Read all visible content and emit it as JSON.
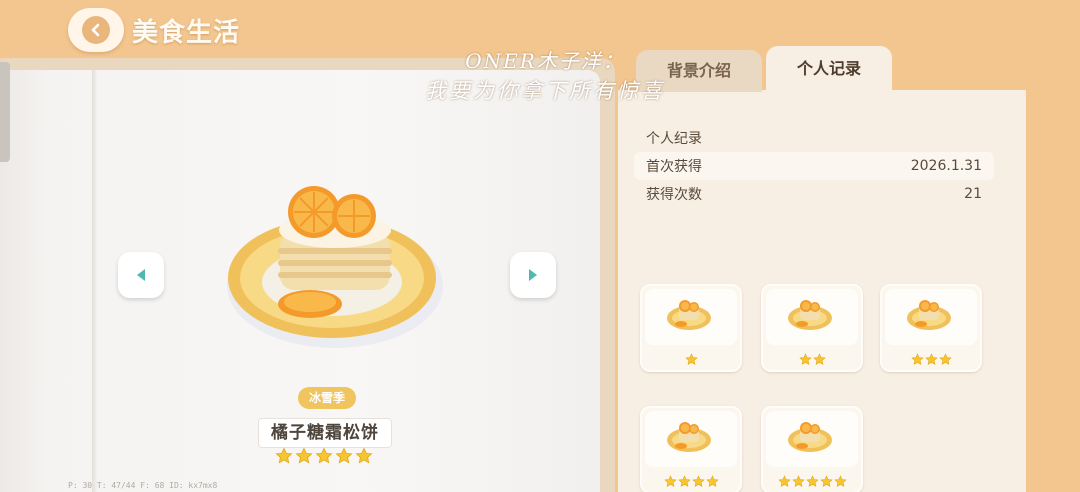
{
  "header": {
    "title": "美食生活",
    "back_icon": "chevron-left-icon"
  },
  "watermark": {
    "line1": "ONER木子洋：",
    "line2": "我要为你拿下所有惊喜"
  },
  "food": {
    "season_badge": "冰雪季",
    "name": "橘子糖霜松饼",
    "rating": 5
  },
  "tabs": [
    {
      "label": "背景介绍",
      "active": false
    },
    {
      "label": "个人记录",
      "active": true
    }
  ],
  "record": {
    "section_title": "个人纪录",
    "rows": [
      {
        "label": "首次获得",
        "value": "2026.1.31"
      },
      {
        "label": "获得次数",
        "value": "21"
      }
    ]
  },
  "variants": [
    {
      "stars": 1
    },
    {
      "stars": 2
    },
    {
      "stars": 3
    },
    {
      "stars": 4
    },
    {
      "stars": 5
    }
  ],
  "debug_text": "P: 30   T: 47/44   F: 68   ID: kx7mx8",
  "colors": {
    "background": "#f3c68f",
    "accent": "#e9b77c",
    "star": "#f7c531",
    "nav_arrow": "#4fb9b0"
  }
}
